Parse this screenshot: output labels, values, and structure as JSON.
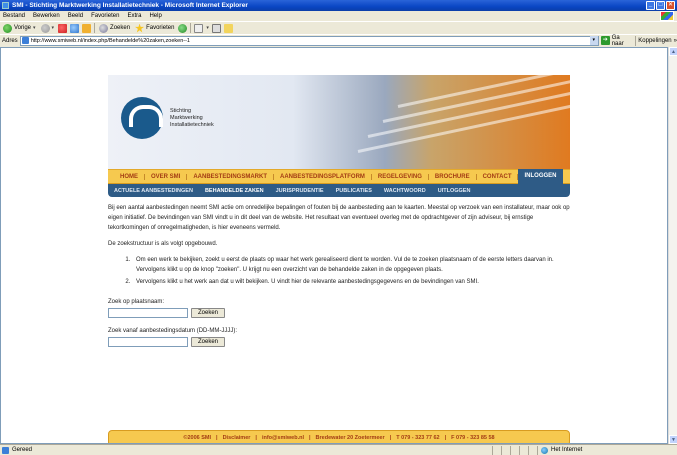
{
  "window": {
    "title": "SMI - Stichting Marktwerking Installatietechniek - Microsoft Internet Explorer",
    "min": "_",
    "max": "□",
    "close": "✕"
  },
  "menu": [
    "Bestand",
    "Bewerken",
    "Beeld",
    "Favorieten",
    "Extra",
    "Help"
  ],
  "toolbar": {
    "back_label": "Vorige",
    "search_label": "Zoeken",
    "favorites_label": "Favorieten"
  },
  "address": {
    "label": "Adres",
    "url": "http://www.smiweb.nl/index.php/Behandelde%20zaken,zoeken--1",
    "go_label": "Ga naar",
    "links_label": "Koppelingen"
  },
  "site": {
    "logo_lines": [
      "Stichting",
      "Marktwerking",
      "Installatietechniek"
    ],
    "main_nav": [
      "HOME",
      "OVER SMI",
      "AANBESTEDINGSMARKT",
      "AANBESTEDINGSPLATFORM",
      "REGELGEVING",
      "BROCHURE",
      "CONTACT",
      "INLOGGEN"
    ],
    "main_nav_active": "INLOGGEN",
    "sub_nav": [
      "ACTUELE AANBESTEDINGEN",
      "BEHANDELDE ZAKEN",
      "JURISPRUDENTIE",
      "PUBLICATIES",
      "WACHTWOORD",
      "UITLOGGEN"
    ],
    "sub_nav_active": "BEHANDELDE ZAKEN",
    "intro": "Bij een aantal aanbestedingen neemt SMI actie om onredelijke bepalingen of fouten bij de aanbesteding aan te kaarten. Meestal op verzoek van een installateur, maar ook op eigen initiatief. De bevindingen van SMI vindt u in dit deel van de website. Het resultaat van eventueel overleg met de opdrachtgever of zijn adviseur, bij ernstige tekortkomingen of onregelmatigheden, is hier eveneens vermeld.",
    "structure_intro": "De zoekstructuur is als volgt opgebouwd.",
    "steps": [
      "Om een werk te bekijken, zoekt u eerst de plaats op waar het werk gerealiseerd dient te worden. Vul de te zoeken plaatsnaam of de eerste letters daarvan in. Vervolgens klikt u op de knop \"zoeken\". U krijgt nu een overzicht van de behandelde zaken in de opgegeven plaats.",
      "Vervolgens klikt u het werk aan dat u wilt bekijken. U vindt hier de relevante aanbestedingsgegevens en de bevindingen van SMI."
    ],
    "search_place_label": "Zoek op plaatsnaam:",
    "search_place_value": "",
    "search_place_button": "Zoeken",
    "search_date_label": "Zoek vanaf aanbestedingsdatum (DD-MM-JJJJ):",
    "search_date_value": "",
    "search_date_button": "Zoeken",
    "footer": [
      "©2006 SMI",
      "Disclaimer",
      "info@smiweb.nl",
      "Bredewater 20 Zoetermeer",
      "T 079 - 323 77 62",
      "F 079 - 323 85 58"
    ]
  },
  "status": {
    "left": "Gereed",
    "zone": "Het Internet"
  },
  "colors": {
    "nav_bg": "#f6c94f",
    "nav_text": "#a33c14",
    "subnav_bg": "#2e5b86",
    "logo_blue": "#1a5a8c"
  }
}
